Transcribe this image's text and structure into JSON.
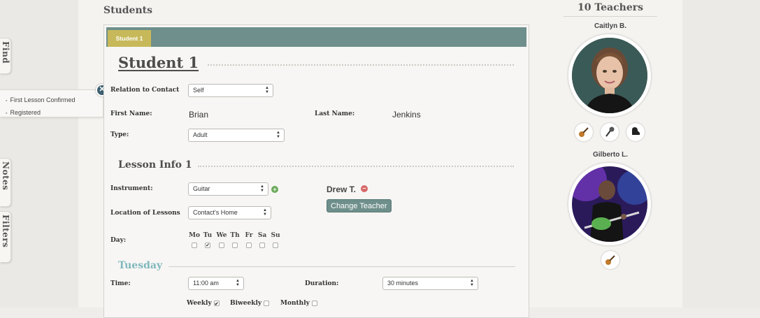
{
  "left_tabs": {
    "find": "Find",
    "notes": "Notes",
    "filters": "Filters"
  },
  "status_list": [
    "First Lesson Confirmed",
    "Registered"
  ],
  "page": {
    "title": "Students"
  },
  "tabs": [
    {
      "label": "Student 1"
    }
  ],
  "student": {
    "heading": "Student 1",
    "relation_label": "Relation to Contact",
    "relation_value": "Self",
    "first_name_label": "First Name:",
    "first_name": "Brian",
    "last_name_label": "Last Name:",
    "last_name": "Jenkins",
    "type_label": "Type:",
    "type_value": "Adult"
  },
  "lesson": {
    "heading": "Lesson Info 1",
    "instrument_label": "Instrument:",
    "instrument_value": "Guitar",
    "teacher_name": "Drew T.",
    "change_teacher_label": "Change Teacher",
    "location_label": "Location of Lessons",
    "location_value": "Contact's Home",
    "day_label": "Day:",
    "days": [
      {
        "abbr": "Mo",
        "checked": false
      },
      {
        "abbr": "Tu",
        "checked": true
      },
      {
        "abbr": "We",
        "checked": false
      },
      {
        "abbr": "Th",
        "checked": false
      },
      {
        "abbr": "Fr",
        "checked": false
      },
      {
        "abbr": "Sa",
        "checked": false
      },
      {
        "abbr": "Su",
        "checked": false
      }
    ],
    "day_heading": "Tuesday",
    "time_label": "Time:",
    "time_value": "11:00 am",
    "duration_label": "Duration:",
    "duration_value": "30 minutes",
    "frequency": [
      {
        "label": "Weekly",
        "checked": true
      },
      {
        "label": "Biweekly",
        "checked": false
      },
      {
        "label": "Monthly",
        "checked": false
      }
    ]
  },
  "teachers": {
    "title": "10 Teachers",
    "list": [
      {
        "name": "Caitlyn B.",
        "instruments": [
          "guitar-icon",
          "microphone-icon",
          "piano-icon"
        ]
      },
      {
        "name": "Gilberto L.",
        "instruments": [
          "guitar-icon"
        ]
      }
    ]
  },
  "colors": {
    "tabbar": "#6e8f8b",
    "active_tab": "#c7b95a",
    "day_heading": "#7fb8bd",
    "close_button": "#3d5f6f",
    "add_icon": "#6aa95a",
    "remove_icon": "#d86a6a"
  }
}
